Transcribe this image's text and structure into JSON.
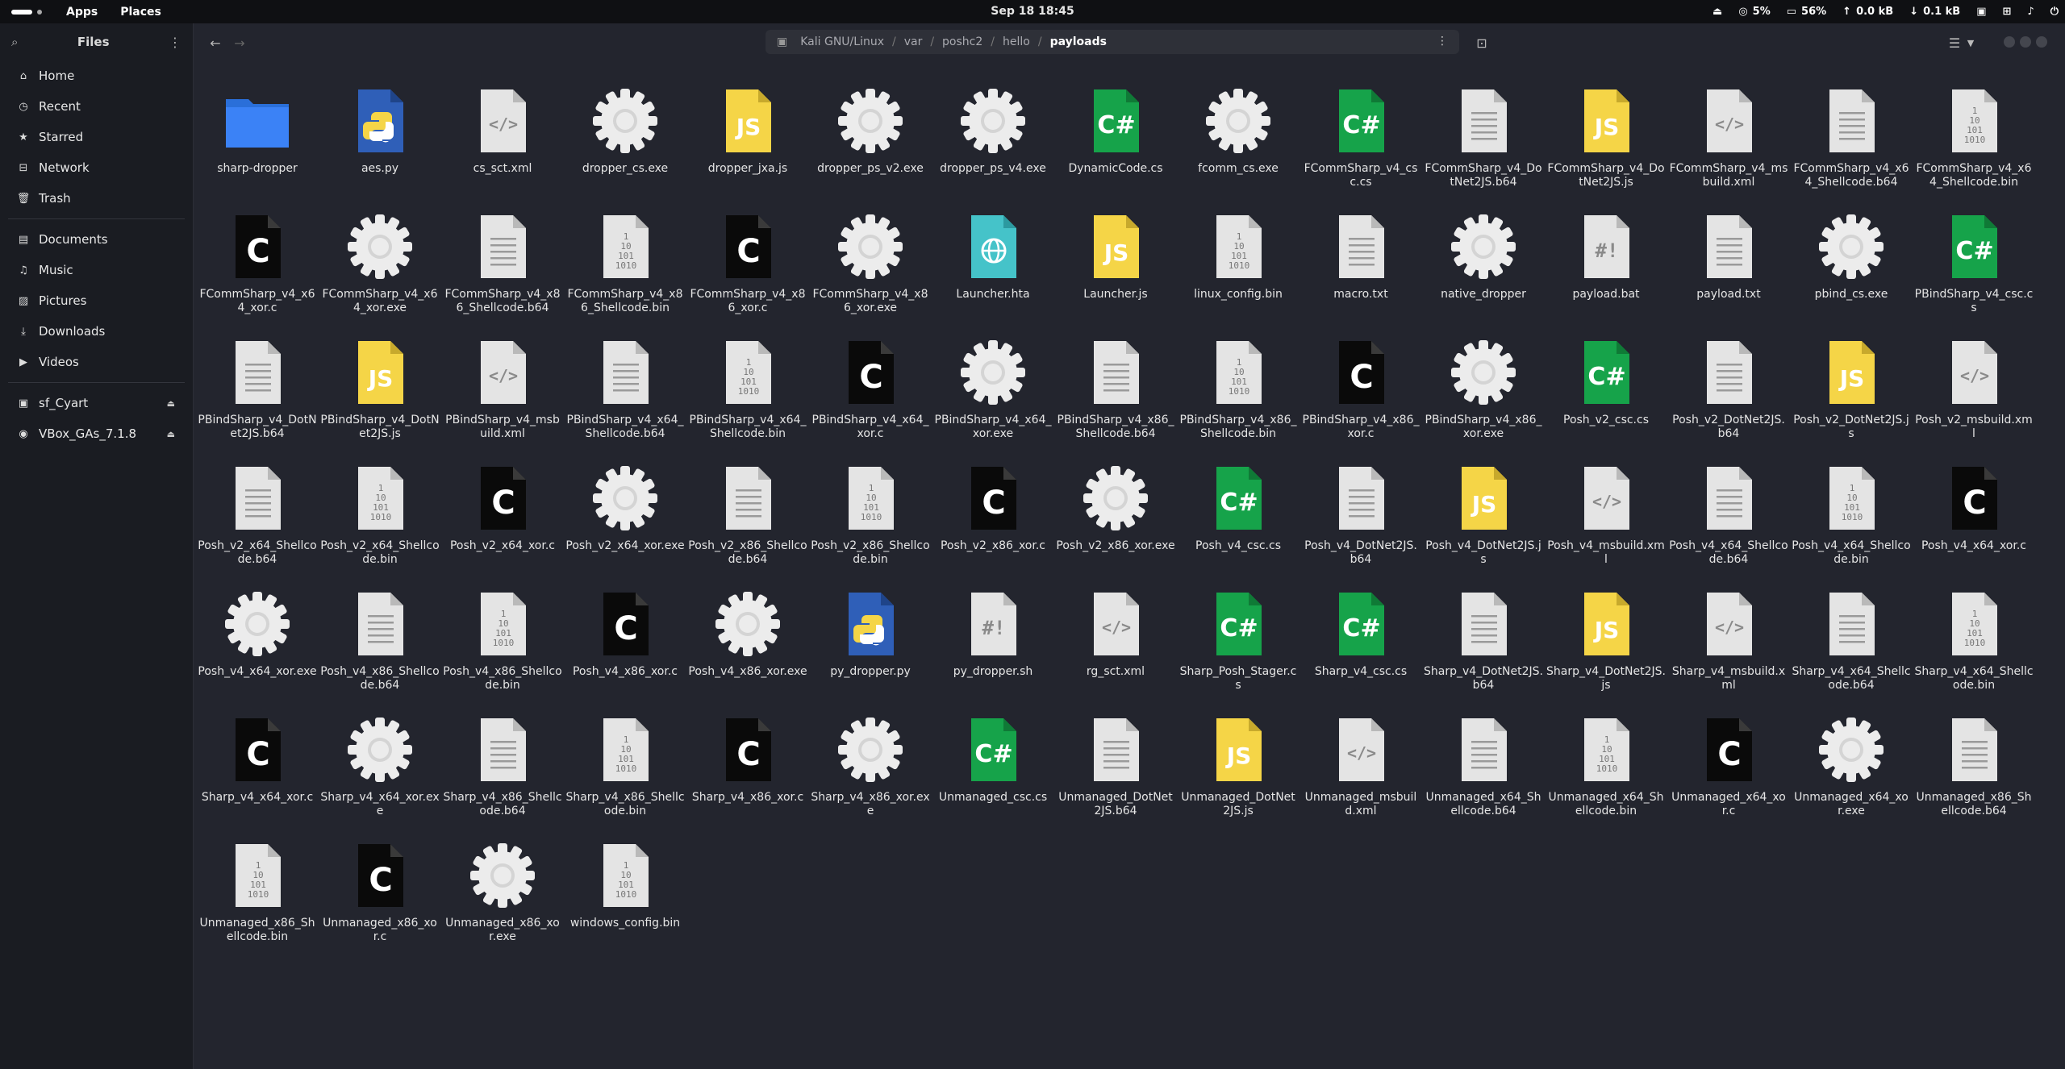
{
  "topbar": {
    "apps": "Apps",
    "places": "Places",
    "clock": "Sep 18  18:45",
    "cpu": "5%",
    "mem": "56%",
    "net_up": "0.0 kB",
    "net_down": "0.1 kB"
  },
  "sidebar": {
    "title": "Files",
    "places": [
      {
        "label": "Home",
        "icon": "home-icon"
      },
      {
        "label": "Recent",
        "icon": "clock-icon"
      },
      {
        "label": "Starred",
        "icon": "star-icon"
      },
      {
        "label": "Network",
        "icon": "network-icon"
      },
      {
        "label": "Trash",
        "icon": "trash-icon"
      }
    ],
    "folders": [
      {
        "label": "Documents",
        "icon": "document-icon"
      },
      {
        "label": "Music",
        "icon": "music-icon"
      },
      {
        "label": "Pictures",
        "icon": "picture-icon"
      },
      {
        "label": "Downloads",
        "icon": "download-icon"
      },
      {
        "label": "Videos",
        "icon": "video-icon"
      }
    ],
    "devices": [
      {
        "label": "sf_Cyart",
        "icon": "drive-icon"
      },
      {
        "label": "VBox_GAs_7.1.8",
        "icon": "disc-icon"
      }
    ]
  },
  "path": {
    "segments": [
      "Kali GNU/Linux",
      "var",
      "poshc2",
      "hello"
    ],
    "current": "payloads"
  },
  "files": [
    {
      "name": "sharp-dropper",
      "type": "folder"
    },
    {
      "name": "aes.py",
      "type": "py"
    },
    {
      "name": "cs_sct.xml",
      "type": "xml"
    },
    {
      "name": "dropper_cs.exe",
      "type": "exe"
    },
    {
      "name": "dropper_jxa.js",
      "type": "js"
    },
    {
      "name": "dropper_ps_v2.exe",
      "type": "exe"
    },
    {
      "name": "dropper_ps_v4.exe",
      "type": "exe"
    },
    {
      "name": "DynamicCode.cs",
      "type": "cs"
    },
    {
      "name": "fcomm_cs.exe",
      "type": "exe"
    },
    {
      "name": "FCommSharp_v4_csc.cs",
      "type": "cs"
    },
    {
      "name": "FCommSharp_v4_DotNet2JS.b64",
      "type": "txt"
    },
    {
      "name": "FCommSharp_v4_DotNet2JS.js",
      "type": "js"
    },
    {
      "name": "FCommSharp_v4_msbuild.xml",
      "type": "xml"
    },
    {
      "name": "FCommSharp_v4_x64_Shellcode.b64",
      "type": "txt"
    },
    {
      "name": "FCommSharp_v4_x64_Shellcode.bin",
      "type": "bin"
    },
    {
      "name": "FCommSharp_v4_x64_xor.c",
      "type": "c"
    },
    {
      "name": "FCommSharp_v4_x64_xor.exe",
      "type": "exe"
    },
    {
      "name": "FCommSharp_v4_x86_Shellcode.b64",
      "type": "txt"
    },
    {
      "name": "FCommSharp_v4_x86_Shellcode.bin",
      "type": "bin"
    },
    {
      "name": "FCommSharp_v4_x86_xor.c",
      "type": "c"
    },
    {
      "name": "FCommSharp_v4_x86_xor.exe",
      "type": "exe"
    },
    {
      "name": "Launcher.hta",
      "type": "hta"
    },
    {
      "name": "Launcher.js",
      "type": "js"
    },
    {
      "name": "linux_config.bin",
      "type": "bin"
    },
    {
      "name": "macro.txt",
      "type": "txt"
    },
    {
      "name": "native_dropper",
      "type": "exe"
    },
    {
      "name": "payload.bat",
      "type": "sh"
    },
    {
      "name": "payload.txt",
      "type": "txt"
    },
    {
      "name": "pbind_cs.exe",
      "type": "exe"
    },
    {
      "name": "PBindSharp_v4_csc.cs",
      "type": "cs"
    },
    {
      "name": "PBindSharp_v4_DotNet2JS.b64",
      "type": "txt"
    },
    {
      "name": "PBindSharp_v4_DotNet2JS.js",
      "type": "js"
    },
    {
      "name": "PBindSharp_v4_msbuild.xml",
      "type": "xml"
    },
    {
      "name": "PBindSharp_v4_x64_Shellcode.b64",
      "type": "txt"
    },
    {
      "name": "PBindSharp_v4_x64_Shellcode.bin",
      "type": "bin"
    },
    {
      "name": "PBindSharp_v4_x64_xor.c",
      "type": "c"
    },
    {
      "name": "PBindSharp_v4_x64_xor.exe",
      "type": "exe"
    },
    {
      "name": "PBindSharp_v4_x86_Shellcode.b64",
      "type": "txt"
    },
    {
      "name": "PBindSharp_v4_x86_Shellcode.bin",
      "type": "bin"
    },
    {
      "name": "PBindSharp_v4_x86_xor.c",
      "type": "c"
    },
    {
      "name": "PBindSharp_v4_x86_xor.exe",
      "type": "exe"
    },
    {
      "name": "Posh_v2_csc.cs",
      "type": "cs"
    },
    {
      "name": "Posh_v2_DotNet2JS.b64",
      "type": "txt"
    },
    {
      "name": "Posh_v2_DotNet2JS.js",
      "type": "js"
    },
    {
      "name": "Posh_v2_msbuild.xml",
      "type": "xml"
    },
    {
      "name": "Posh_v2_x64_Shellcode.b64",
      "type": "txt"
    },
    {
      "name": "Posh_v2_x64_Shellcode.bin",
      "type": "bin"
    },
    {
      "name": "Posh_v2_x64_xor.c",
      "type": "c"
    },
    {
      "name": "Posh_v2_x64_xor.exe",
      "type": "exe"
    },
    {
      "name": "Posh_v2_x86_Shellcode.b64",
      "type": "txt"
    },
    {
      "name": "Posh_v2_x86_Shellcode.bin",
      "type": "bin"
    },
    {
      "name": "Posh_v2_x86_xor.c",
      "type": "c"
    },
    {
      "name": "Posh_v2_x86_xor.exe",
      "type": "exe"
    },
    {
      "name": "Posh_v4_csc.cs",
      "type": "cs"
    },
    {
      "name": "Posh_v4_DotNet2JS.b64",
      "type": "txt"
    },
    {
      "name": "Posh_v4_DotNet2JS.js",
      "type": "js"
    },
    {
      "name": "Posh_v4_msbuild.xml",
      "type": "xml"
    },
    {
      "name": "Posh_v4_x64_Shellcode.b64",
      "type": "txt"
    },
    {
      "name": "Posh_v4_x64_Shellcode.bin",
      "type": "bin"
    },
    {
      "name": "Posh_v4_x64_xor.c",
      "type": "c"
    },
    {
      "name": "Posh_v4_x64_xor.exe",
      "type": "exe"
    },
    {
      "name": "Posh_v4_x86_Shellcode.b64",
      "type": "txt"
    },
    {
      "name": "Posh_v4_x86_Shellcode.bin",
      "type": "bin"
    },
    {
      "name": "Posh_v4_x86_xor.c",
      "type": "c"
    },
    {
      "name": "Posh_v4_x86_xor.exe",
      "type": "exe"
    },
    {
      "name": "py_dropper.py",
      "type": "py"
    },
    {
      "name": "py_dropper.sh",
      "type": "sh"
    },
    {
      "name": "rg_sct.xml",
      "type": "xml"
    },
    {
      "name": "Sharp_Posh_Stager.cs",
      "type": "cs"
    },
    {
      "name": "Sharp_v4_csc.cs",
      "type": "cs"
    },
    {
      "name": "Sharp_v4_DotNet2JS.b64",
      "type": "txt"
    },
    {
      "name": "Sharp_v4_DotNet2JS.js",
      "type": "js"
    },
    {
      "name": "Sharp_v4_msbuild.xml",
      "type": "xml"
    },
    {
      "name": "Sharp_v4_x64_Shellcode.b64",
      "type": "txt"
    },
    {
      "name": "Sharp_v4_x64_Shellcode.bin",
      "type": "bin"
    },
    {
      "name": "Sharp_v4_x64_xor.c",
      "type": "c"
    },
    {
      "name": "Sharp_v4_x64_xor.exe",
      "type": "exe"
    },
    {
      "name": "Sharp_v4_x86_Shellcode.b64",
      "type": "txt"
    },
    {
      "name": "Sharp_v4_x86_Shellcode.bin",
      "type": "bin"
    },
    {
      "name": "Sharp_v4_x86_xor.c",
      "type": "c"
    },
    {
      "name": "Sharp_v4_x86_xor.exe",
      "type": "exe"
    },
    {
      "name": "Unmanaged_csc.cs",
      "type": "cs"
    },
    {
      "name": "Unmanaged_DotNet2JS.b64",
      "type": "txt"
    },
    {
      "name": "Unmanaged_DotNet2JS.js",
      "type": "js"
    },
    {
      "name": "Unmanaged_msbuild.xml",
      "type": "xml"
    },
    {
      "name": "Unmanaged_x64_Shellcode.b64",
      "type": "txt"
    },
    {
      "name": "Unmanaged_x64_Shellcode.bin",
      "type": "bin"
    },
    {
      "name": "Unmanaged_x64_xor.c",
      "type": "c"
    },
    {
      "name": "Unmanaged_x64_xor.exe",
      "type": "exe"
    },
    {
      "name": "Unmanaged_x86_Shellcode.b64",
      "type": "txt"
    },
    {
      "name": "Unmanaged_x86_Shellcode.bin",
      "type": "bin"
    },
    {
      "name": "Unmanaged_x86_xor.c",
      "type": "c"
    },
    {
      "name": "Unmanaged_x86_xor.exe",
      "type": "exe"
    },
    {
      "name": "windows_config.bin",
      "type": "bin"
    }
  ],
  "icon_glyphs": {
    "c": "C",
    "cs": "C#",
    "js": "JS",
    "sh": "#!",
    "bin": "1\n10\n101\n1010"
  },
  "colors": {
    "folder": "#3b82f6",
    "cs": "#16a34a",
    "js": "#f5d547",
    "c": "#0a0a0a",
    "hta": "#45c3c9",
    "py": "#2f5fb8",
    "doc": "#e4e4e4"
  }
}
